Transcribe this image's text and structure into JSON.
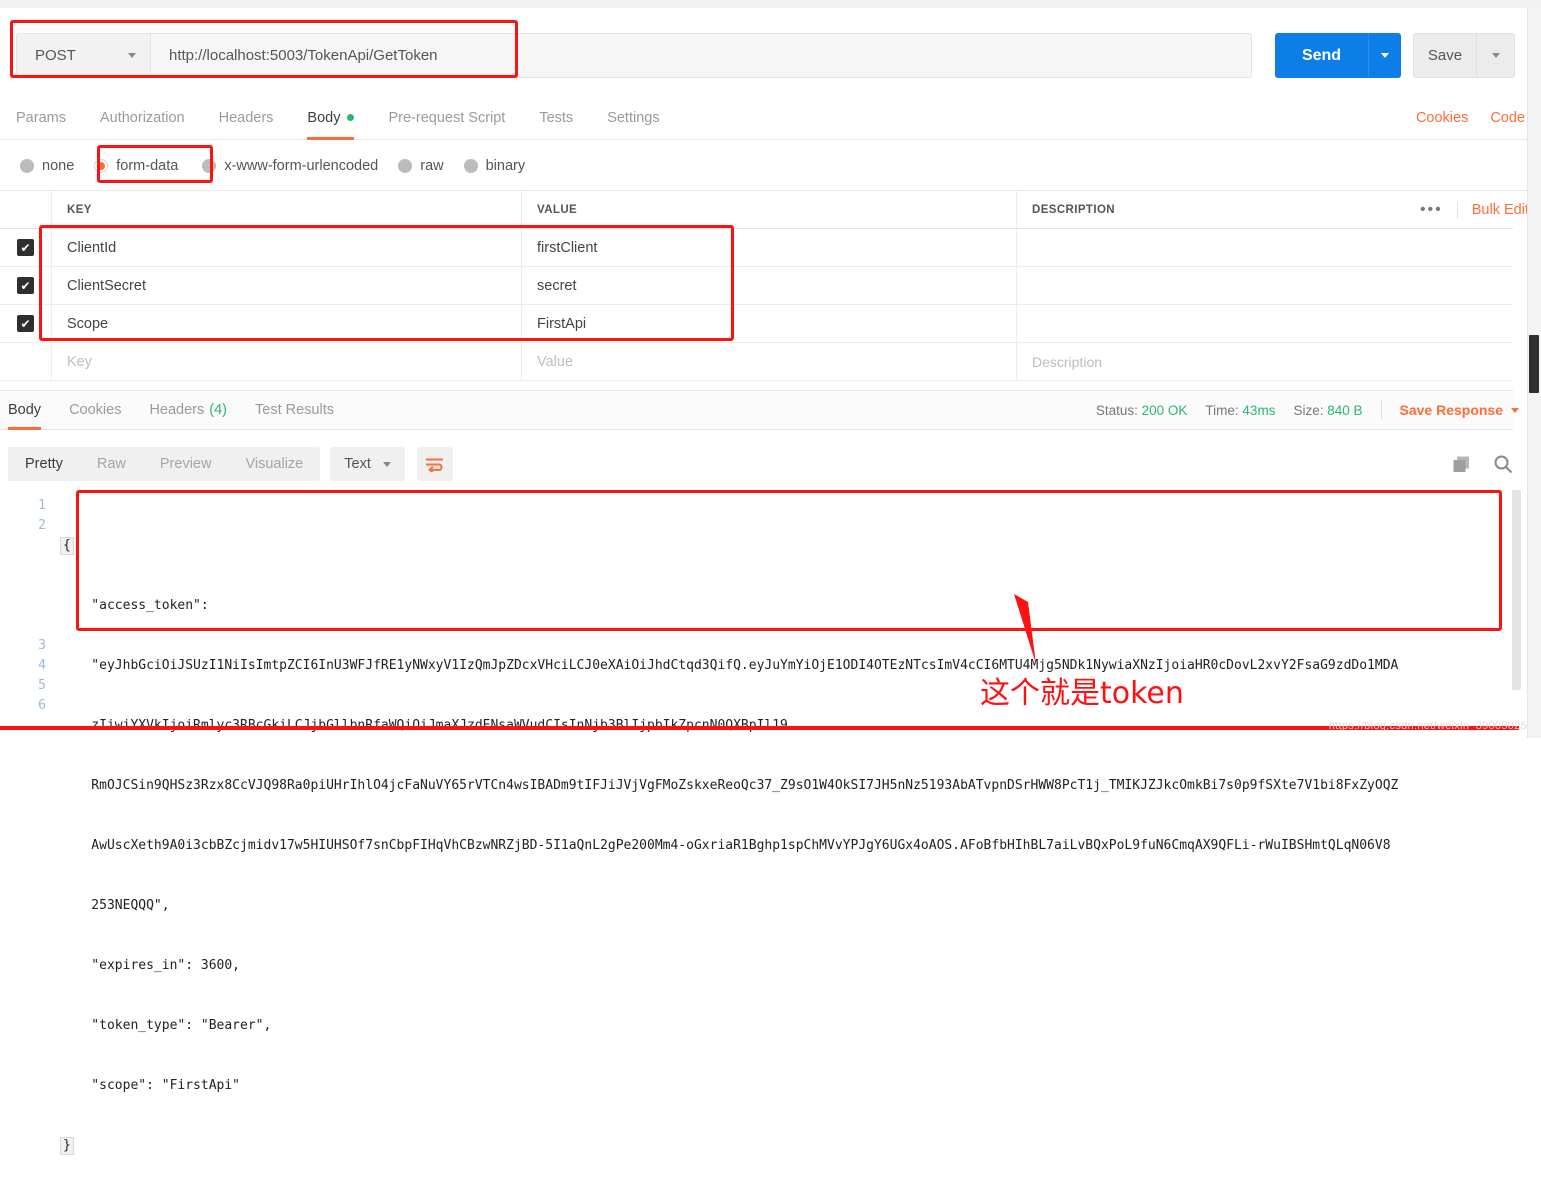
{
  "urlbar": {
    "method": "POST",
    "url": "http://localhost:5003/TokenApi/GetToken",
    "send_label": "Send",
    "save_label": "Save"
  },
  "request_tabs": [
    {
      "label": "Params",
      "active": false
    },
    {
      "label": "Authorization",
      "active": false
    },
    {
      "label": "Headers",
      "active": false
    },
    {
      "label": "Body",
      "active": true,
      "dot": true
    },
    {
      "label": "Pre-request Script",
      "active": false
    },
    {
      "label": "Tests",
      "active": false
    },
    {
      "label": "Settings",
      "active": false
    }
  ],
  "top_right_links": {
    "cookies": "Cookies",
    "code": "Code"
  },
  "body_types": [
    {
      "label": "none",
      "selected": false
    },
    {
      "label": "form-data",
      "selected": true
    },
    {
      "label": "x-www-form-urlencoded",
      "selected": false
    },
    {
      "label": "raw",
      "selected": false
    },
    {
      "label": "binary",
      "selected": false
    }
  ],
  "kv_table": {
    "headers": {
      "key": "KEY",
      "value": "VALUE",
      "description": "DESCRIPTION"
    },
    "bulk_edit_label": "Bulk Edit",
    "dots": "•••",
    "rows": [
      {
        "checked": true,
        "key": "ClientId",
        "value": "firstClient",
        "description": ""
      },
      {
        "checked": true,
        "key": "ClientSecret",
        "value": "secret",
        "description": ""
      },
      {
        "checked": true,
        "key": "Scope",
        "value": "FirstApi",
        "description": ""
      }
    ],
    "placeholder_row": {
      "key": "Key",
      "value": "Value",
      "description": "Description"
    }
  },
  "response_tabs": [
    {
      "label": "Body",
      "active": true
    },
    {
      "label": "Cookies",
      "active": false
    },
    {
      "label": "Headers",
      "active": false,
      "count": "(4)"
    },
    {
      "label": "Test Results",
      "active": false
    }
  ],
  "response_meta": {
    "status_label": "Status:",
    "status_value": "200 OK",
    "time_label": "Time:",
    "time_value": "43ms",
    "size_label": "Size:",
    "size_value": "840 B",
    "save_response_label": "Save Response"
  },
  "view_toolbar": {
    "segments": [
      {
        "label": "Pretty",
        "active": true
      },
      {
        "label": "Raw",
        "active": false
      },
      {
        "label": "Preview",
        "active": false
      },
      {
        "label": "Visualize",
        "active": false
      }
    ],
    "format": "Text",
    "wrap_icon": "word-wrap-icon",
    "copy_icon": "copy-icon",
    "search_icon": "search-icon"
  },
  "code": {
    "line_numbers": [
      "1",
      "2",
      "3",
      "4",
      "5",
      "6"
    ],
    "lines": [
      "{",
      "    \"access_token\":",
      "    \"eyJhbGciOiJSUzI1NiIsImtpZCI6InU3WFJfRE1yNWxyV1IzQmJpZDcxVHciLCJ0eXAiOiJhdCtqd3QifQ.eyJuYmYiOjE1ODI4OTEzNTcsImV4cCI6MTU4Mjg5NDk1NywiaXNzIjoiaHR0cDovL2xvY2FsaG9zdDo1MDA",
      "    zIiwiYXVkIjoiRmlyc3RBcGkiLCJjbGllbnRfaWQiOiJmaXJzdENsaWVudCIsInNjb3BlIjpbIkZpcnN0QXBpIl19.",
      "    RmOJCSin9QHSz3Rzx8CcVJQ98Ra0piUHrIhlO4jcFaNuVY65rVTCn4wsIBADm9tIFJiJVjVgFMoZskxeReoQc37_Z9sO1W4OkSI7JH5nNz5193AbATvpnDSrHWW8PcT1j_TMIKJZJkcOmkBi7s0p9fSXte7V1bi8FxZyOQZ",
      "    AwUscXeth9A0i3cbBZcjmidv17w5HIUHSOf7snCbpFIHqVhCBzwNRZjBD-5I1aQnL2gPe200Mm4-oGxriaR1Bghp1spChMVvYPJgY6UGx4oAOS.AFoBfbHIhBL7aiLvBQxPoL9fuN6CmqAX9QFLi-rWuIBSHmtQLqN06V8",
      "    253NEQQQ\",",
      "    \"expires_in\": 3600,",
      "    \"token_type\": \"Bearer\",",
      "    \"scope\": \"FirstApi\"",
      "}"
    ]
  },
  "annotation": {
    "text": "这个就是token",
    "color": "#fc1212"
  },
  "watermark": "https://blog.csdn.net/weixin_39005025",
  "colors": {
    "accent_orange": "#ff6c37",
    "send_blue": "#0d7ee8",
    "status_green": "#2bb673",
    "annotation_red": "#fc1212"
  }
}
